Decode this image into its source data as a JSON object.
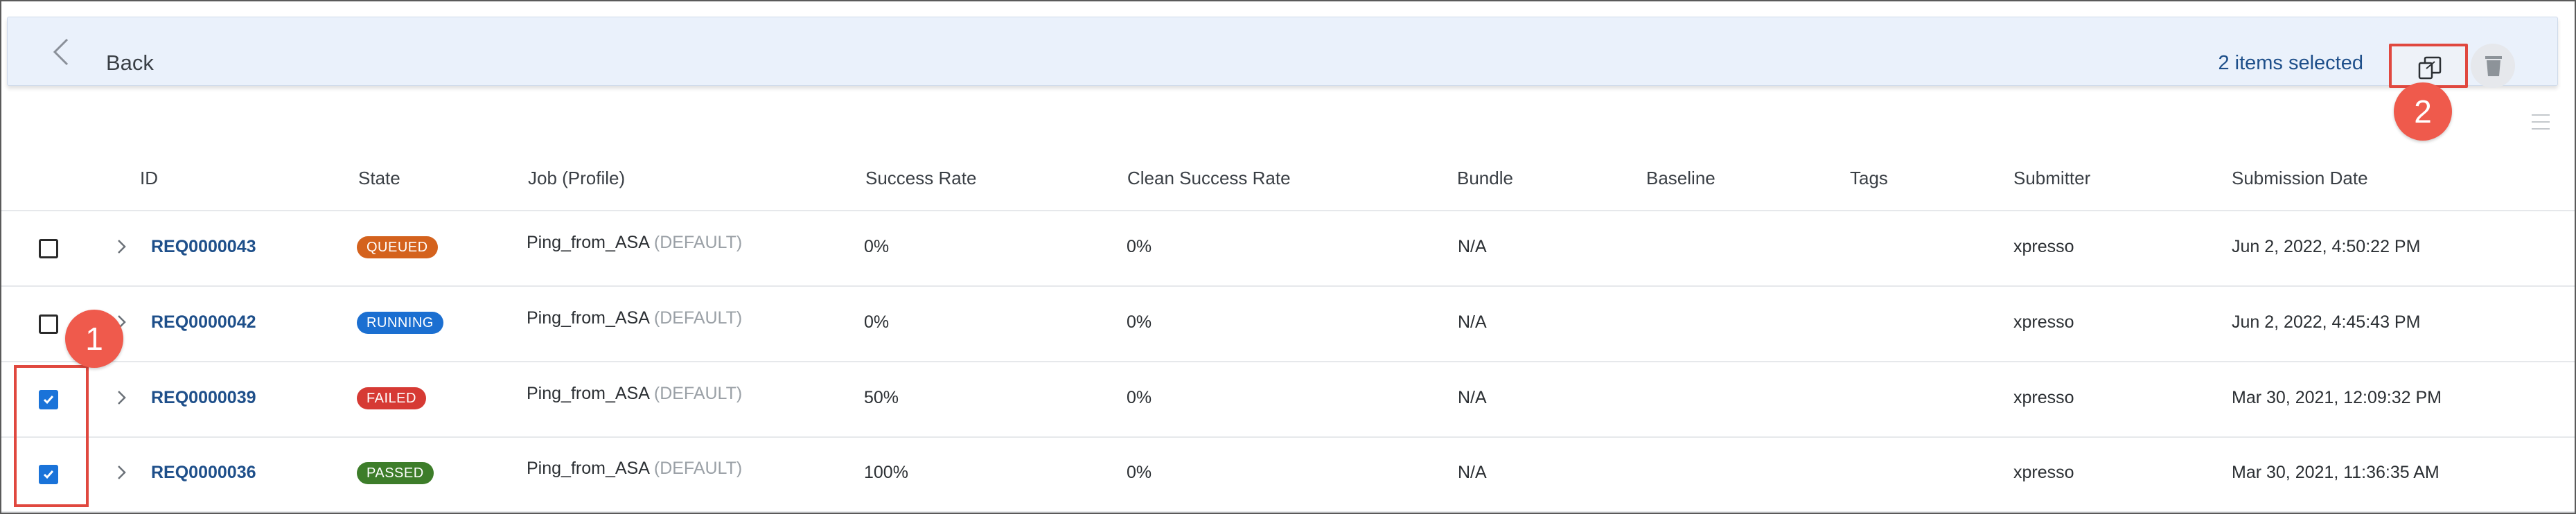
{
  "toolbar": {
    "back_label": "Back",
    "selected_text": "2 items selected",
    "icons": {
      "back": "chevron-left-icon",
      "copy": "copy-icon",
      "delete": "trash-icon"
    }
  },
  "callouts": [
    "1",
    "2"
  ],
  "table": {
    "columns": [
      "ID",
      "State",
      "Job (Profile)",
      "Success Rate",
      "Clean Success Rate",
      "Bundle",
      "Baseline",
      "Tags",
      "Submitter",
      "Submission Date"
    ],
    "rows": [
      {
        "selected": false,
        "id": "REQ0000043",
        "state": "QUEUED",
        "state_color": "#d4621d",
        "job": "Ping_from_ASA",
        "profile": "(DEFAULT)",
        "success_rate": "0%",
        "clean_success_rate": "0%",
        "bundle": "N/A",
        "baseline": "",
        "tags": "",
        "submitter": "xpresso",
        "submission_date": "Jun 2, 2022, 4:50:22 PM"
      },
      {
        "selected": false,
        "id": "REQ0000042",
        "state": "RUNNING",
        "state_color": "#1b6fd1",
        "job": "Ping_from_ASA",
        "profile": "(DEFAULT)",
        "success_rate": "0%",
        "clean_success_rate": "0%",
        "bundle": "N/A",
        "baseline": "",
        "tags": "",
        "submitter": "xpresso",
        "submission_date": "Jun 2, 2022, 4:45:43 PM"
      },
      {
        "selected": true,
        "id": "REQ0000039",
        "state": "FAILED",
        "state_color": "#d63a34",
        "job": "Ping_from_ASA",
        "profile": "(DEFAULT)",
        "success_rate": "50%",
        "clean_success_rate": "0%",
        "bundle": "N/A",
        "baseline": "",
        "tags": "",
        "submitter": "xpresso",
        "submission_date": "Mar 30, 2021, 12:09:32 PM"
      },
      {
        "selected": true,
        "id": "REQ0000036",
        "state": "PASSED",
        "state_color": "#3d7d2a",
        "job": "Ping_from_ASA",
        "profile": "(DEFAULT)",
        "success_rate": "100%",
        "clean_success_rate": "0%",
        "bundle": "N/A",
        "baseline": "",
        "tags": "",
        "submitter": "xpresso",
        "submission_date": "Mar 30, 2021, 11:36:35 AM"
      }
    ]
  },
  "colors": {
    "accent": "#1a73d9",
    "link": "#1e4f8a",
    "callout": "#ef5a4c",
    "toolbar_bg": "#eaf1fb"
  }
}
